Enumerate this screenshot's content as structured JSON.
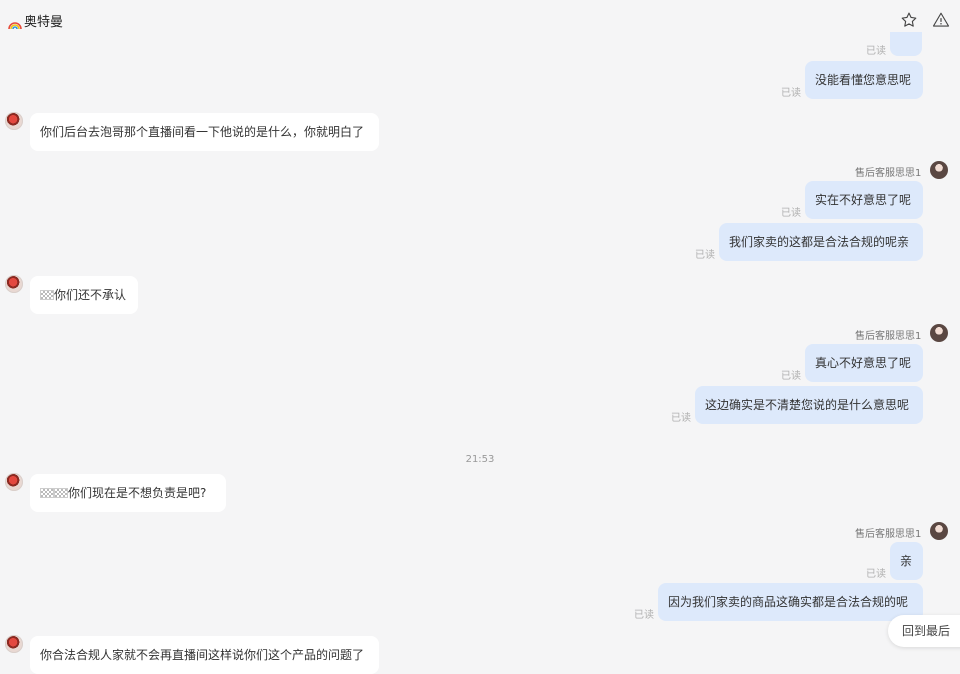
{
  "header": {
    "title": "奥特曼",
    "title_icon": "rainbow-icon",
    "actions": [
      {
        "icon": "star-outline-icon"
      },
      {
        "icon": "warning-triangle-icon"
      }
    ]
  },
  "read_label": "已读",
  "agent_name": "售后客服思思1",
  "timestamp": "21:53",
  "messages": {
    "m0": {
      "text": ""
    },
    "m1": {
      "text": "没能看懂您意思呢"
    },
    "m2": {
      "text": "你们后台去泡哥那个直播间看一下他说的是什么，你就明白了"
    },
    "m3": {
      "text": "实在不好意思了呢"
    },
    "m4": {
      "text": "我们家卖的这都是合法合规的呢亲"
    },
    "m5": {
      "text": "你们还不承认"
    },
    "m6": {
      "text": "真心不好意思了呢"
    },
    "m7": {
      "text": "这边确实是不清楚您说的是什么意思呢"
    },
    "m8": {
      "text": "你们现在是不想负责是吧?"
    },
    "m9": {
      "text": "亲"
    },
    "m10": {
      "text": "因为我们家卖的商品这确实都是合法合规的呢"
    },
    "m11": {
      "text": "你合法合规人家就不会再直播间这样说你们这个产品的问题了"
    }
  },
  "back_to_latest": "回到最后",
  "colors": {
    "background": "#f5f5f6",
    "bubble_incoming": "#ffffff",
    "bubble_outgoing": "#dde9fb",
    "read_text": "#b0b0b0"
  }
}
